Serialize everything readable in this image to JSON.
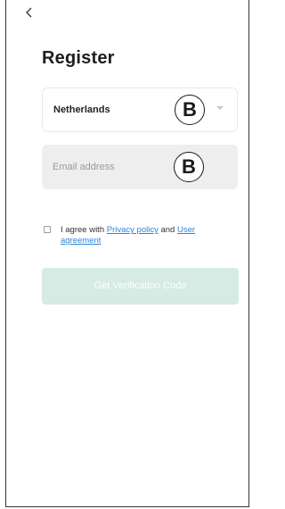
{
  "header": {
    "back_icon": "chevron-left-icon",
    "title": "Register"
  },
  "country": {
    "value": "Netherlands",
    "badge": "B",
    "dropdown_icon": "chevron-down-icon"
  },
  "email": {
    "placeholder": "Email address",
    "value": "",
    "badge": "B"
  },
  "agreement": {
    "checked": false,
    "prefix": "I agree with ",
    "privacy_link": "Privacy policy",
    "conjunction": " and ",
    "user_link": "User agreement"
  },
  "cta": {
    "label": "Get Verification Code",
    "enabled": false
  },
  "colors": {
    "accent_link": "#2f86d6",
    "cta_disabled": "#d5ebe3",
    "field_bg": "#eeeeee"
  }
}
